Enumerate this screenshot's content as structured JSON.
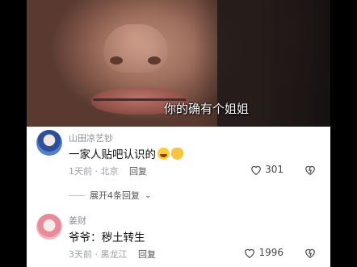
{
  "video": {
    "subtitle": "你的确有个姐姐"
  },
  "comments": [
    {
      "username": "山田凉艺钞",
      "text": "一家人贴吧认识的",
      "emojis": [
        "laugh-crying-icon",
        "ok-hand-icon"
      ],
      "time": "1天前",
      "location": "北京",
      "reply_label": "回复",
      "likes": "301"
    },
    {
      "username": "姜财",
      "text": "爷爷：秽土转生",
      "time": "3天前",
      "location": "黑龙江",
      "reply_label": "回复",
      "likes": "1996"
    }
  ],
  "expand_replies": "展开4条回复"
}
